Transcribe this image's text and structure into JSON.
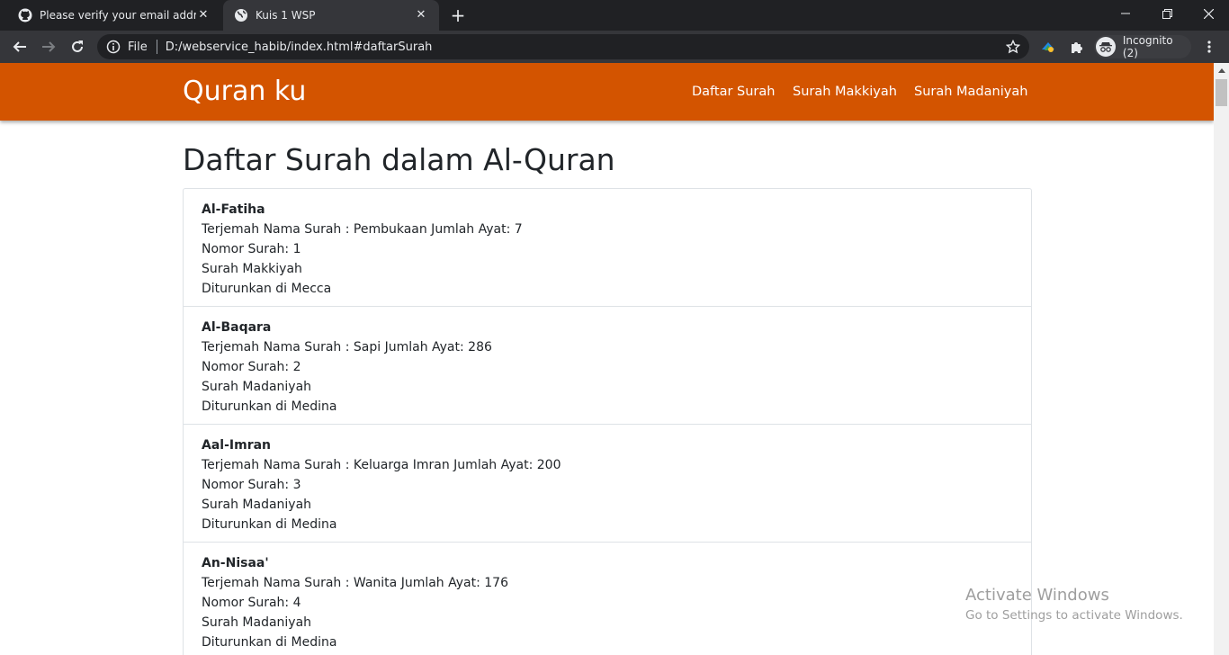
{
  "browser": {
    "tabs": [
      {
        "title": "Please verify your email address",
        "favicon": "github-icon"
      },
      {
        "title": "Kuis 1 WSP",
        "favicon": "globe-icon"
      }
    ],
    "omnibox": {
      "scheme": "File",
      "url": "D:/webservice_habib/index.html#daftarSurah"
    },
    "incognito_label": "Incognito (2)"
  },
  "navbar": {
    "brand": "Quran ku",
    "links": [
      "Daftar Surah",
      "Surah Makkiyah",
      "Surah Madaniyah"
    ],
    "color": "#d35400"
  },
  "page": {
    "heading": "Daftar Surah dalam Al-Quran",
    "surahs": [
      {
        "name": "Al-Fatiha",
        "translation_line": "Terjemah Nama Surah : Pembukaan Jumlah Ayat: 7",
        "number_line": "Nomor Surah: 1",
        "type_line": "Surah Makkiyah",
        "revealed_line": "Diturunkan di Mecca"
      },
      {
        "name": "Al-Baqara",
        "translation_line": "Terjemah Nama Surah : Sapi Jumlah Ayat: 286",
        "number_line": "Nomor Surah: 2",
        "type_line": "Surah Madaniyah",
        "revealed_line": "Diturunkan di Medina"
      },
      {
        "name": "Aal-Imran",
        "translation_line": "Terjemah Nama Surah : Keluarga Imran Jumlah Ayat: 200",
        "number_line": "Nomor Surah: 3",
        "type_line": "Surah Madaniyah",
        "revealed_line": "Diturunkan di Medina"
      },
      {
        "name": "An-Nisaa'",
        "translation_line": "Terjemah Nama Surah : Wanita Jumlah Ayat: 176",
        "number_line": "Nomor Surah: 4",
        "type_line": "Surah Madaniyah",
        "revealed_line": "Diturunkan di Medina"
      }
    ]
  },
  "watermark": {
    "title": "Activate Windows",
    "subtitle": "Go to Settings to activate Windows."
  }
}
